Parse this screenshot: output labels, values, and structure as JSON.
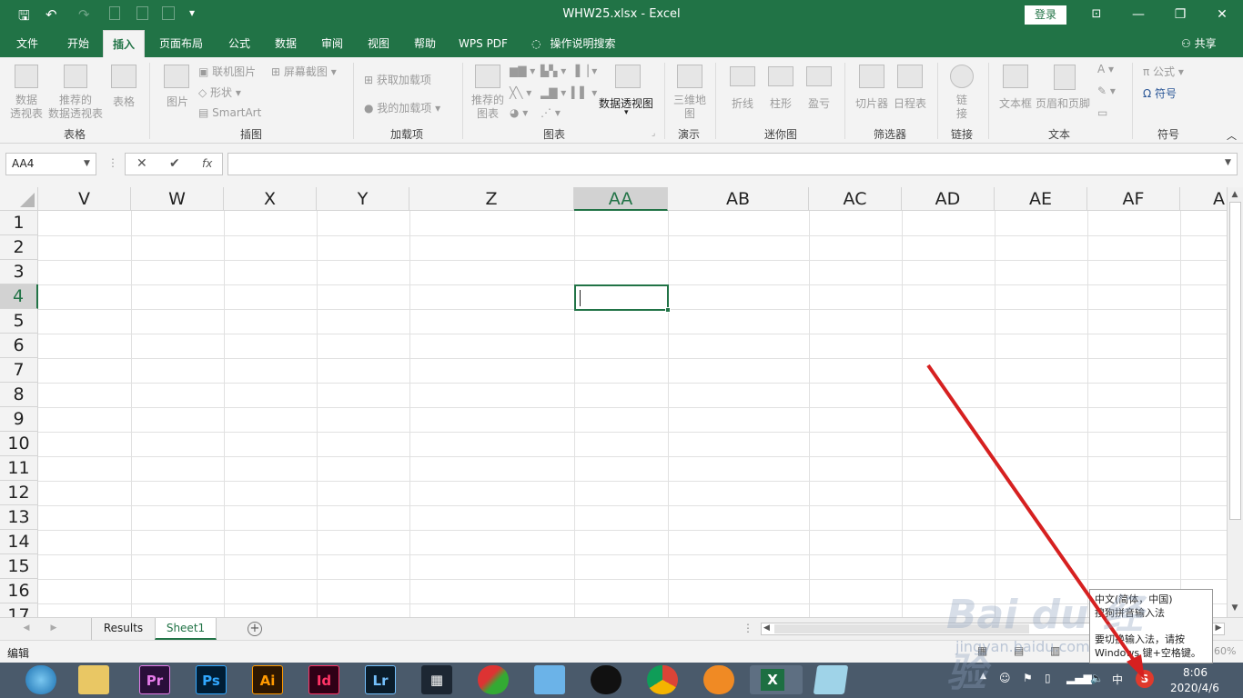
{
  "window": {
    "doc_title": "WHW25.xlsx  -  Excel",
    "login_label": "登录",
    "controls": {
      "ribbon_toggle_icon": "ribbon-display-icon",
      "minimize": "—",
      "restore": "❐",
      "close": "✕"
    }
  },
  "quick_access": {
    "save": "🖫",
    "undo": "↶",
    "redo": "↷",
    "more": "▾"
  },
  "menu": {
    "tabs": [
      "文件",
      "开始",
      "插入",
      "页面布局",
      "公式",
      "数据",
      "审阅",
      "视图",
      "帮助",
      "WPS PDF"
    ],
    "active_tab": "插入",
    "tell_me": "操作说明搜索",
    "share": "共享"
  },
  "ribbon": {
    "tables": {
      "pivot": "数据\n透视表",
      "recommended_pivot": "推荐的\n数据透视表",
      "table": "表格",
      "label": "表格"
    },
    "illustrations": {
      "picture": "图片",
      "online_picture": "联机图片",
      "shapes": "形状",
      "smartart": "SmartArt",
      "screenshot": "屏幕截图",
      "label": "插图"
    },
    "addins": {
      "get": "获取加载项",
      "my": "我的加载项",
      "label": "加载项"
    },
    "charts": {
      "recommended": "推荐的\n图表",
      "pivot_chart": "数据透视图",
      "label": "图表"
    },
    "tours": {
      "map3d": "三维地\n图",
      "label": "演示"
    },
    "sparklines": {
      "line": "折线",
      "column": "柱形",
      "winloss": "盈亏",
      "label": "迷你图"
    },
    "filters": {
      "slicer": "切片器",
      "timeline": "日程表",
      "label": "筛选器"
    },
    "links": {
      "link": "链\n接",
      "label": "链接"
    },
    "text": {
      "textbox": "文本框",
      "header_footer": "页眉和页脚",
      "label": "文本"
    },
    "symbols": {
      "equation": "π 公式",
      "symbol": "Ω 符号",
      "label": "符号"
    }
  },
  "formula_bar": {
    "name_box": "AA4",
    "cancel": "✕",
    "enter": "✔",
    "fx": "fx",
    "formula": ""
  },
  "grid": {
    "columns": [
      "V",
      "W",
      "X",
      "Y",
      "Z",
      "AA",
      "AB",
      "AC",
      "AD",
      "AE",
      "AF",
      "A"
    ],
    "selected_column": "AA",
    "rows": [
      "1",
      "2",
      "3",
      "4",
      "5",
      "6",
      "7",
      "8",
      "9",
      "10",
      "11",
      "12",
      "13",
      "14",
      "15",
      "16",
      "17"
    ],
    "selected_row": "4",
    "active_cell": "AA4"
  },
  "sheets": {
    "tabs": [
      "Results",
      "Sheet1"
    ],
    "active": "Sheet1",
    "add": "+"
  },
  "status": {
    "mode": "编辑",
    "zoom": "60%"
  },
  "taskbar": {
    "apps": [
      "Pr",
      "Ps",
      "Ai",
      "Id",
      "Lr"
    ],
    "tray": {
      "ime": "中",
      "time": "8:06",
      "date": "2020/4/6"
    }
  },
  "ime_popup": {
    "line1": "中文(简体，中国)",
    "line2": "搜狗拼音输入法",
    "line3": "要切换输入法，请按",
    "line4": "Windows 键+空格键。"
  },
  "watermark": {
    "text": "Bai du 经验",
    "url": "jingyan.baidu.com"
  }
}
